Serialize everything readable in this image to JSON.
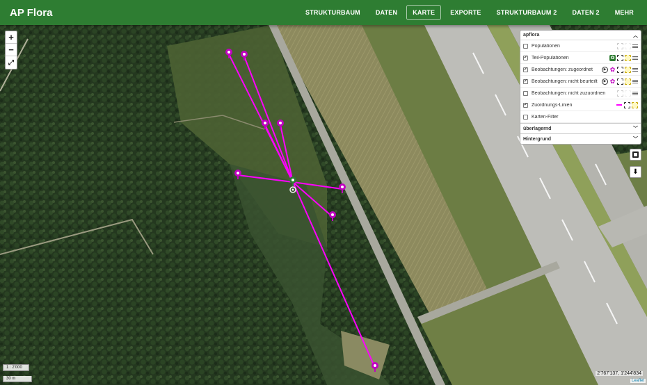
{
  "app": {
    "title": "AP Flora"
  },
  "nav": [
    {
      "label": "STRUKTURBAUM",
      "active": false
    },
    {
      "label": "DATEN",
      "active": false
    },
    {
      "label": "KARTE",
      "active": true
    },
    {
      "label": "EXPORTE",
      "active": false
    },
    {
      "label": "STRUKTURBAUM 2",
      "active": false
    },
    {
      "label": "DATEN 2",
      "active": false
    },
    {
      "label": "MEHR",
      "active": false
    }
  ],
  "map_controls": {
    "zoom_in": "+",
    "zoom_out": "−",
    "fullscreen": "⤢"
  },
  "layer_panel": {
    "title": "apflora",
    "layers": [
      {
        "label": "Populationen",
        "checked": false
      },
      {
        "label": "Teil-Populationen",
        "checked": true
      },
      {
        "label": "Beobachtungen: zugeordnet",
        "checked": true
      },
      {
        "label": "Beobachtungen: nicht beurteilt",
        "checked": true
      },
      {
        "label": "Beobachtungen: nicht zuzuordnen",
        "checked": false
      },
      {
        "label": "Zuordnungs-Linien",
        "checked": true
      },
      {
        "label": "Karten-Filter",
        "checked": false
      }
    ],
    "sections": [
      {
        "label": "überlagernd"
      },
      {
        "label": "Hintergrund"
      }
    ]
  },
  "scale": {
    "ratio": "1 : 2'000",
    "distance": "30 m"
  },
  "coordinates": "2'767'137, 1'244'834",
  "attribution": "Leaflet",
  "colors": {
    "appbar": "#2e7d32",
    "line": "#ff00ff",
    "marker": "#c000c0",
    "tpop": "#2e7d32"
  }
}
